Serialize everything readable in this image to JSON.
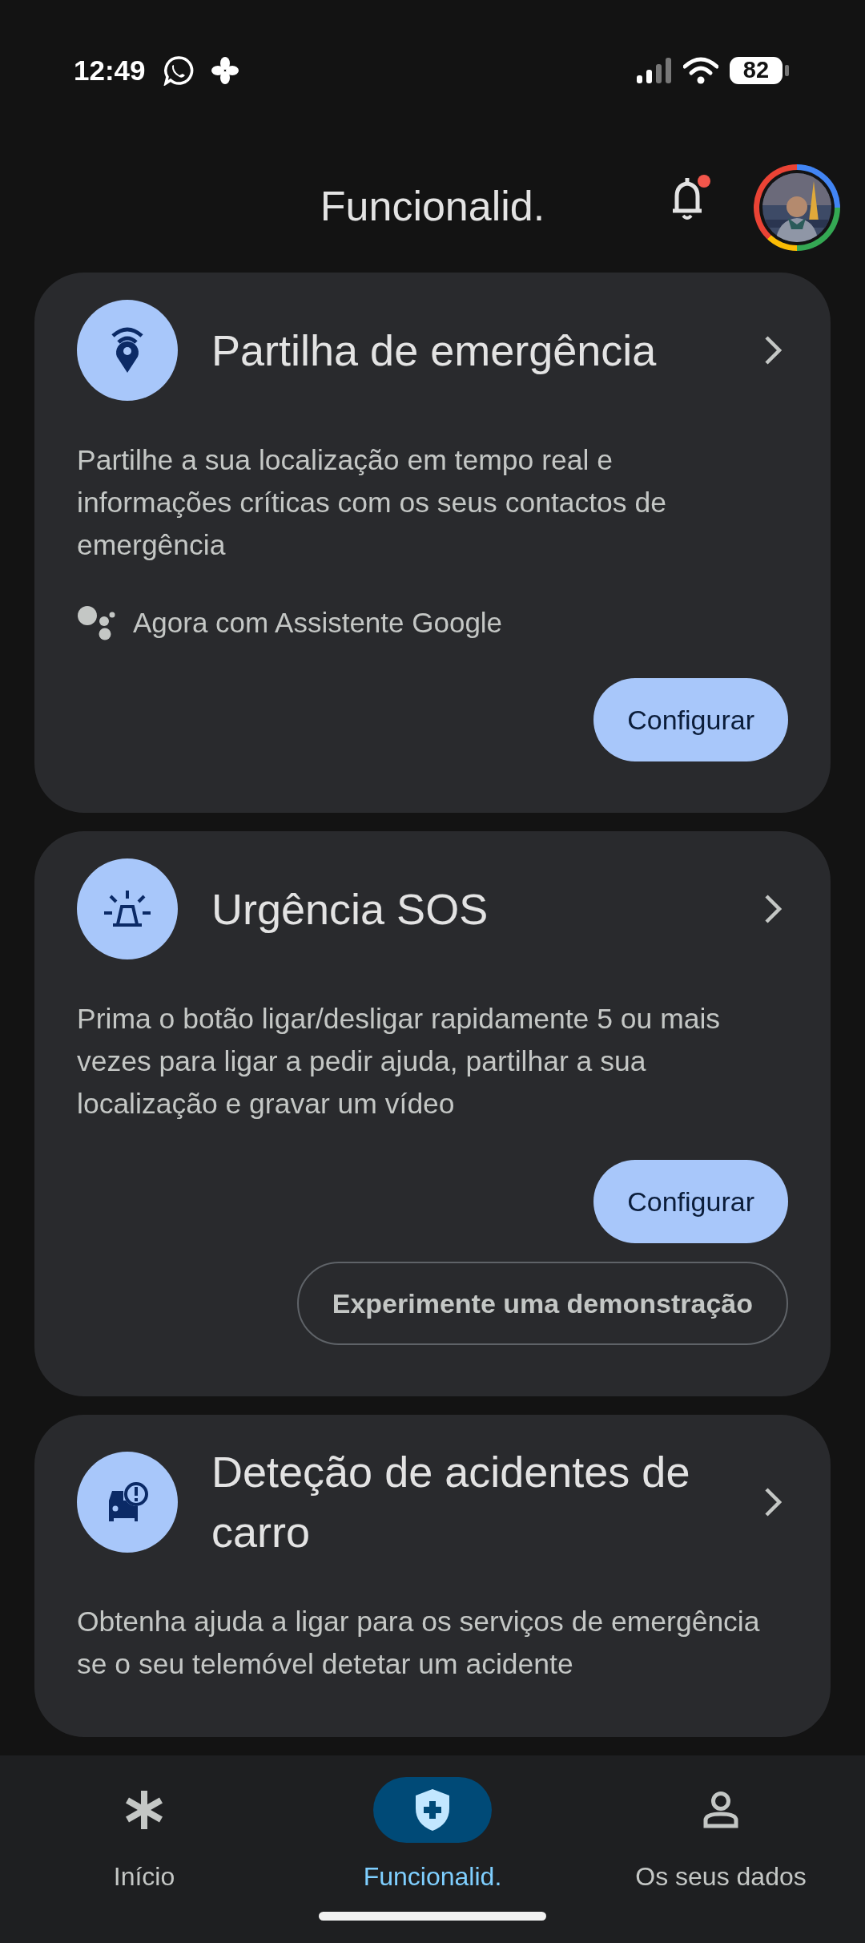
{
  "status_bar": {
    "time": "12:49",
    "battery": "82"
  },
  "header": {
    "title": "Funcionalid."
  },
  "cards": [
    {
      "title": "Partilha de emergência",
      "description": "Partilhe a sua localização em tempo real e informações críticas com os seus contactos de emergência",
      "note": "Agora com Assistente Google",
      "buttons": [
        {
          "kind": "filled",
          "label": "Configurar"
        }
      ]
    },
    {
      "title": "Urgência SOS",
      "description": "Prima o botão ligar/desligar rapidamente 5 ou mais vezes para ligar a pedir ajuda, partilhar a sua localização e gravar um vídeo",
      "buttons": [
        {
          "kind": "filled",
          "label": "Configurar"
        },
        {
          "kind": "outlined",
          "label": "Experimente uma demonstração"
        }
      ]
    },
    {
      "title": "Deteção de acidentes de carro",
      "description": "Obtenha ajuda a ligar para os serviços de emergência se o seu telemóvel detetar um acidente"
    }
  ],
  "bottom_nav": [
    {
      "label": "Início",
      "selected": false
    },
    {
      "label": "Funcionalid.",
      "selected": true
    },
    {
      "label": "Os seus dados",
      "selected": false
    }
  ]
}
